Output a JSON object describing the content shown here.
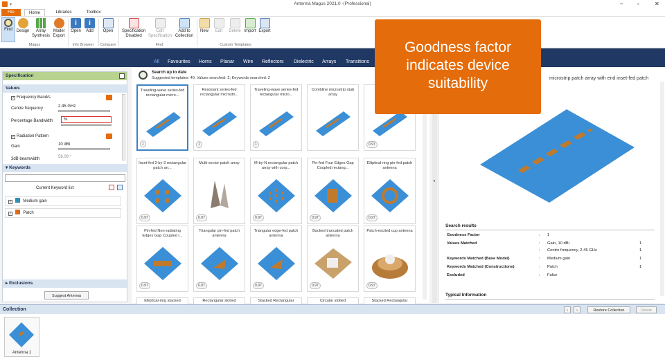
{
  "window": {
    "title": "Antenna Magus 2021.0 -(Professional)"
  },
  "ribbon_tabs": [
    {
      "label": "File"
    },
    {
      "label": "Home"
    },
    {
      "label": "Libraries"
    },
    {
      "label": "Toolbox"
    }
  ],
  "ribbon": {
    "buttons": {
      "find": "Find",
      "design": "Design",
      "array_synthesis": "Array Synthesis",
      "model_export": "Model Export",
      "open": "Open",
      "add": "Add",
      "open2": "Open",
      "spec_disabled": "Specification Disabled",
      "edit_spec": "Edit Specification",
      "add_to_collection": "Add to Collection",
      "new": "New",
      "edit": "Edit",
      "delete": "Delete",
      "import": "Import",
      "export": "Export"
    },
    "groups": {
      "magus": "Magus",
      "info_browser": "Info Browser",
      "compare": "Compare",
      "find": "Find",
      "custom_templates": "Custom Templates"
    }
  },
  "template_groups": {
    "title": "Template Groups",
    "tabs": [
      "All",
      "Favourites",
      "Horns",
      "Planar",
      "Wire",
      "Reflectors",
      "Dielectric",
      "Arrays",
      "Transitions"
    ]
  },
  "specification": {
    "title": "Specification",
    "values_header": "Values",
    "frequency_band": "Frequency Band/s",
    "centre_frequency_label": "Centre frequency",
    "centre_frequency_value": "2.45 GHz",
    "percentage_bandwidth_label": "Percentage Bandwidth",
    "percentage_bandwidth_value": "%",
    "radiation_pattern": "Radiation Pattern",
    "gain_label": "Gain",
    "gain_value": "10 dBi",
    "beamwidth_label": "3dB beamwidth",
    "beamwidth_value": "58.09 °"
  },
  "keywords": {
    "header": "Keywords",
    "current_label": "Current Keyword list:",
    "items": [
      {
        "label": "Medium gain",
        "color": "#2f8fb8"
      },
      {
        "label": "Patch",
        "color": "#d96b1a"
      }
    ]
  },
  "exclusions": {
    "header": "Exclusions"
  },
  "suggest_button": "Suggest Antenna",
  "search": {
    "title": "Search up to date",
    "subtitle": "Suggested templates: 40; Values searched: 2; Keywords searched: 2"
  },
  "templates": [
    {
      "title": "Traveling-wave series-fed rectangular micro...",
      "gf": "1"
    },
    {
      "title": "Resonant series-fed rectangular microstri...",
      "gf": "1"
    },
    {
      "title": "Traveling-wave series-fed rectangular micro...",
      "gf": "1"
    },
    {
      "title": "Combline microstrip stub array",
      "gf": ""
    },
    {
      "title": "N...",
      "gf": "0.97"
    },
    {
      "title": "Inset-fed 2-by-2 rectangular patch arr...",
      "gf": "0.97"
    },
    {
      "title": "Multi-sector patch array",
      "gf": "0.97"
    },
    {
      "title": "M-by-N rectangular patch array with corp...",
      "gf": "0.97"
    },
    {
      "title": "Pin-fed Four Edges Gap Coupled rectang...",
      "gf": "0.97"
    },
    {
      "title": "Elliptical-ring pin-fed patch antenna",
      "gf": "0.97"
    },
    {
      "title": "Pin-fed Non-radiating Edges Gap Coupled r...",
      "gf": "0.97"
    },
    {
      "title": "Triangular pin-fed patch antenna",
      "gf": "0.97"
    },
    {
      "title": "Triangular edge-fed patch antenna",
      "gf": "0.97"
    },
    {
      "title": "Backed truncated patch antenna",
      "gf": "0.97"
    },
    {
      "title": "Patch-excited cup antenna",
      "gf": "0.97"
    },
    {
      "title": "Elliptical-ring stacked",
      "gf": ""
    },
    {
      "title": "Rectangular slotted",
      "gf": ""
    },
    {
      "title": "Stacked Rectangular",
      "gf": ""
    },
    {
      "title": "Circular slotted",
      "gf": ""
    },
    {
      "title": "Stacked Rectangular",
      "gf": ""
    }
  ],
  "detail": {
    "title": "microstrip patch array with end inset-fed patch",
    "search_results_header": "Search results",
    "rows": [
      {
        "label": "Goodness Factor",
        "value": "1",
        "count": ""
      },
      {
        "label": "Values Matched",
        "value": "Gain, 10 dBi",
        "count": "1"
      },
      {
        "label": "",
        "value": "Centre frequency, 2.45 GHz",
        "count": "1"
      },
      {
        "label": "Keywords Matched (Base Model)",
        "value": "Medium gain",
        "count": "1"
      },
      {
        "label": "Keywords Matched (Constructions)",
        "value": "Patch",
        "count": "1"
      },
      {
        "label": "Excluded",
        "value": "False",
        "count": ""
      }
    ],
    "typical_information": "Typical Information"
  },
  "collection": {
    "header": "Collection",
    "restore": "Restore Collection",
    "delete": "Delete",
    "items": [
      {
        "label": "Antenna 1"
      }
    ]
  },
  "overlay": {
    "line1": "Goodness factor",
    "line2": "indicates device",
    "line3": "suitability"
  },
  "colors": {
    "accent_orange": "#e46c0a",
    "navy": "#1f3864",
    "patch_blue": "#3b8fd6",
    "patch_orange": "#c07a2c"
  }
}
